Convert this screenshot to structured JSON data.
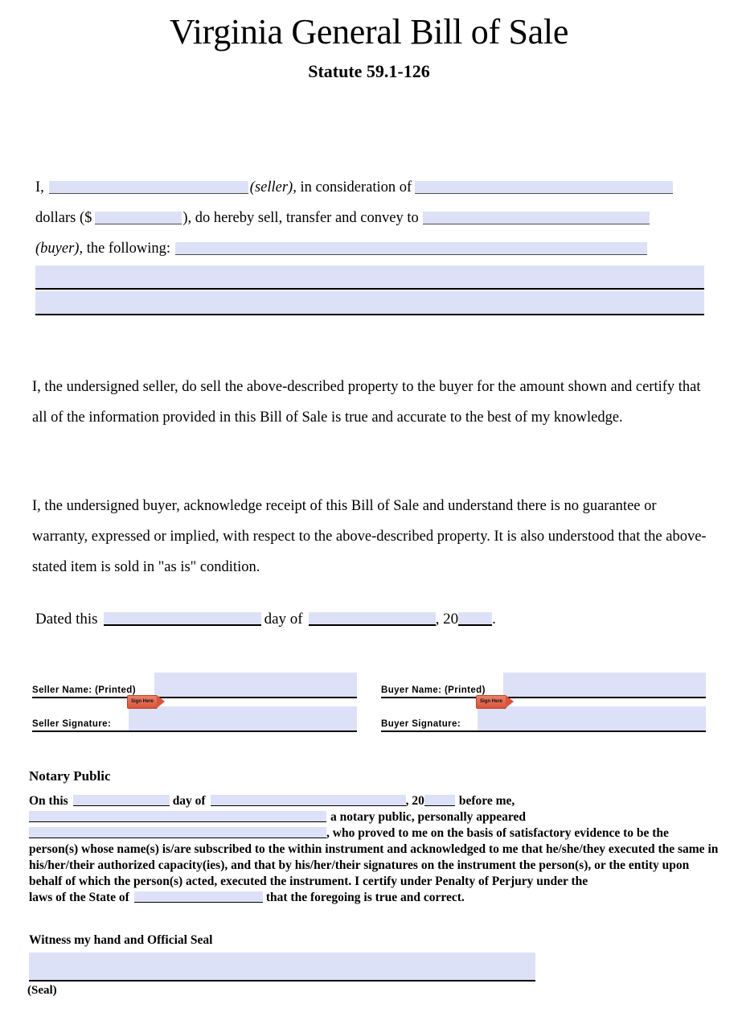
{
  "document": {
    "title": "Virginia General Bill of Sale",
    "subtitle": "Statute 59.1-126"
  },
  "intro": {
    "line1_a": "I,",
    "line1_seller_paren": "(seller)",
    "line1_b": ", in consideration of",
    "line2_a": "dollars ($",
    "line2_b": "), do hereby sell, transfer and convey to",
    "line3_buyer_paren": "(buyer)",
    "line3_b": ", the following:"
  },
  "paragraphs": {
    "seller": "I, the undersigned seller, do sell the above-described property to the buyer for the amount shown and certify that all of the information provided in this Bill of Sale is true and accurate to the best of my knowledge.",
    "buyer": "I, the undersigned buyer, acknowledge receipt of this Bill of Sale and understand there is no guarantee or warranty, expressed or implied, with respect to the above-described property. It is also understood that the above-stated item is sold in \"as is\" condition."
  },
  "dated": {
    "prefix": "Dated this",
    "day_of": "day of",
    "comma_twenty": ", 20",
    "period": "."
  },
  "signatures": {
    "seller": {
      "name_label": "Seller Name: (Printed)",
      "signature_label": "Seller Signature:",
      "sign_tag": "Sign Here"
    },
    "buyer": {
      "name_label": "Buyer Name: (Printed)",
      "signature_label": "Buyer Signature:",
      "sign_tag": "Sign Here"
    }
  },
  "notary": {
    "heading": "Notary Public",
    "on_this": "On this",
    "day_of": "day of",
    "comma_twenty": ", 20",
    "before_me": "before me,",
    "notary_public_appeared": "a notary public, personally appeared",
    "who_proved": ", who proved to me on the basis of satisfactory evidence to be the",
    "body": "person(s) whose name(s) is/are subscribed to the within instrument and acknowledged to me that he/she/they executed the same in his/her/their authorized capacity(ies), and that by his/her/their signatures on the instrument the person(s), or the entity upon behalf of which the person(s) acted, executed the instrument. I certify under Penalty of Perjury under the",
    "laws_of_state": "laws of the State of",
    "foregoing": "that the foregoing is true and correct.",
    "witness": "Witness my hand and Official Seal",
    "seal_label": "(Seal)"
  },
  "colors": {
    "field_fill": "#dde1f7",
    "field_rule": "#000000",
    "sign_tag": "#d8543a",
    "text": "#000000"
  }
}
